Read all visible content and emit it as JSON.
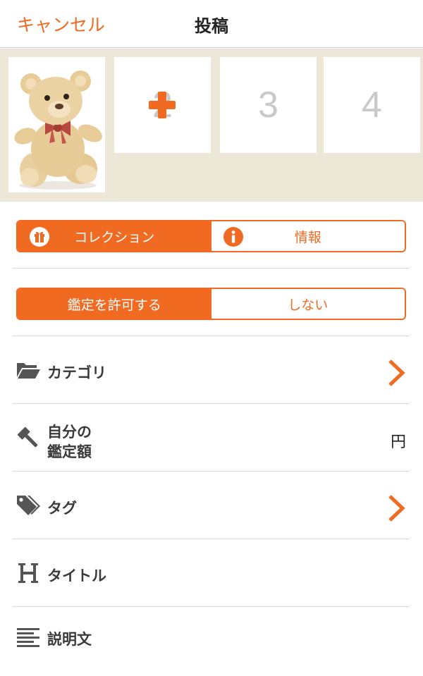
{
  "nav": {
    "cancel_label": "キャンセル",
    "title": "投稿"
  },
  "photos": {
    "slot2_number": "2",
    "slot3_number": "3",
    "slot4_number": "4"
  },
  "mode_toggle": {
    "collection_label": "コレクション",
    "info_label": "情報",
    "selected": "collection"
  },
  "appraisal_toggle": {
    "allow_label": "鑑定を許可する",
    "deny_label": "しない",
    "selected": "allow"
  },
  "fields": {
    "category_label": "カテゴリ",
    "price_label_line1": "自分の",
    "price_label_line2": "鑑定額",
    "price_unit": "円",
    "tag_label": "タグ",
    "title_label": "タイトル",
    "description_label": "説明文"
  },
  "colors": {
    "accent": "#f06a22",
    "strip_background": "#ece7d7",
    "icon_gray": "#555555"
  }
}
